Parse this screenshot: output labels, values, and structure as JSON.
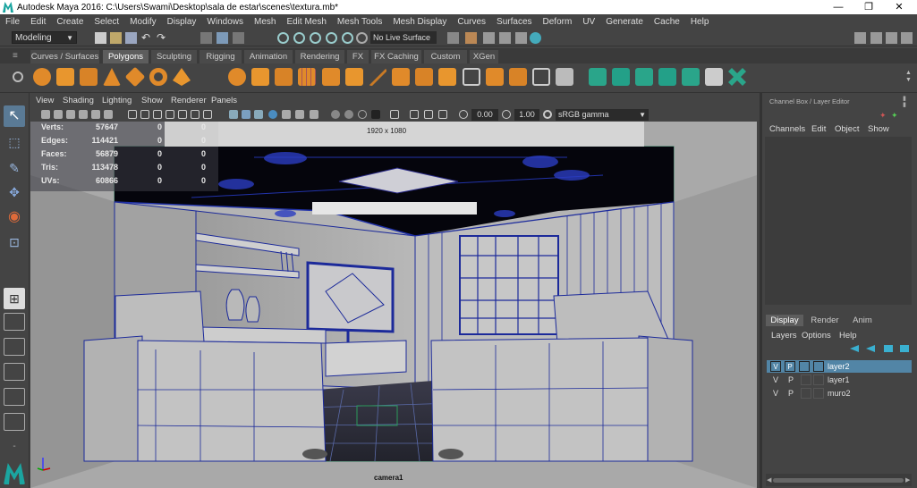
{
  "window": {
    "title": "Autodesk Maya 2016: C:\\Users\\Swami\\Desktop\\sala de estar\\scenes\\textura.mb*",
    "minimize": "—",
    "maximize": "❐",
    "close": "✕"
  },
  "menubar": [
    "File",
    "Edit",
    "Create",
    "Select",
    "Modify",
    "Display",
    "Windows",
    "Mesh",
    "Edit Mesh",
    "Mesh Tools",
    "Mesh Display",
    "Curves",
    "Surfaces",
    "Deform",
    "UV",
    "Generate",
    "Cache",
    "Help"
  ],
  "statusline": {
    "mode": "Modeling",
    "live_surface": "No Live Surface"
  },
  "shelf_tabs": [
    "Curves / Surfaces",
    "Polygons",
    "Sculpting",
    "Rigging",
    "Animation",
    "Rendering",
    "FX",
    "FX Caching",
    "Custom",
    "XGen"
  ],
  "shelf_active": "Polygons",
  "viewport": {
    "menu": [
      "View",
      "Shading",
      "Lighting",
      "Show",
      "Renderer",
      "Panels"
    ],
    "near": "0.00",
    "far": "1.00",
    "color_space": "sRGB gamma",
    "resolution": "1920 x 1080",
    "camera": "camera1",
    "hud": [
      {
        "label": "Verts:",
        "v1": "57647",
        "v2": "0",
        "v3": "0"
      },
      {
        "label": "Edges:",
        "v1": "114421",
        "v2": "0",
        "v3": "0"
      },
      {
        "label": "Faces:",
        "v1": "56879",
        "v2": "0",
        "v3": "0"
      },
      {
        "label": "Tris:",
        "v1": "113478",
        "v2": "0",
        "v3": "0"
      },
      {
        "label": "UVs:",
        "v1": "60866",
        "v2": "0",
        "v3": "0"
      }
    ]
  },
  "right_panel": {
    "title": "Channel Box / Layer Editor",
    "menu": [
      "Channels",
      "Edit",
      "Object",
      "Show"
    ],
    "tabs": [
      "Display",
      "Render",
      "Anim"
    ],
    "active_tab": "Display",
    "layer_menu": [
      "Layers",
      "Options",
      "Help"
    ],
    "layers": [
      {
        "v": "V",
        "p": "P",
        "name": "layer2",
        "selected": true
      },
      {
        "v": "V",
        "p": "P",
        "name": "layer1",
        "selected": false
      },
      {
        "v": "V",
        "p": "P",
        "name": "muro2",
        "selected": false
      }
    ]
  },
  "colors": {
    "accent": "#5285a6",
    "active_tab": "#5d5d5d",
    "viewport_bg": "#a7a7a7",
    "wire": "#1c2a9a"
  }
}
